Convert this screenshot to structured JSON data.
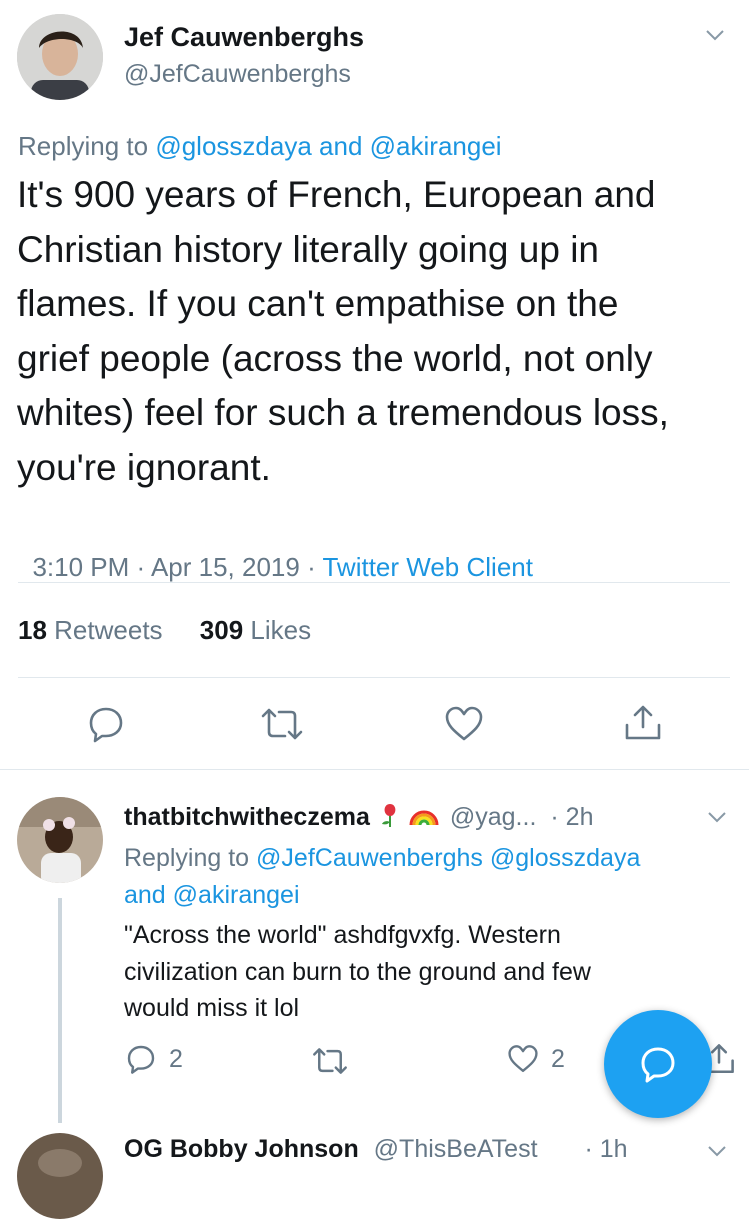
{
  "main_tweet": {
    "author_name": "Jef Cauwenberghs",
    "author_handle": "@JefCauwenberghs",
    "replying_prefix": "Replying to",
    "replying_user1": "@glosszdaya",
    "replying_and": "and",
    "replying_user2": "@akirangei",
    "text_lines": [
      "It's 900 years of French, European and",
      "Christian history literally going up in",
      "flames. If you can't empathise on the",
      "grief people (across the world, not only",
      "whites) feel for such a tremendous loss,",
      "you're ignorant."
    ],
    "timestamp": "3:10 PM · Apr 15, 2019 · ",
    "source": "Twitter Web Client",
    "retweets_count": "18",
    "retweets_label": "Retweets",
    "likes_count": "309",
    "likes_label": "Likes"
  },
  "reply": {
    "author_name": "thatbitchwitheczema",
    "emojis": [
      "rose-emoji",
      "rainbow-emoji"
    ],
    "handle": "@yag...",
    "time": "· 2h",
    "replying_prefix": "Replying to",
    "replying_user1": "@JefCauwenberghs",
    "replying_user2": "@glosszdaya",
    "replying_and": "and",
    "replying_user3": "@akirangei",
    "text_lines": [
      "\"Across the world\" ashdfgvxfg. Western",
      "civilization can burn to the ground and few",
      "would miss it lol"
    ],
    "reply_count": "2",
    "like_count": "2"
  },
  "next_reply": {
    "author_name": "OG Bobby Johnson",
    "handle": "@ThisBeATest",
    "time": "· 1h"
  },
  "colors": {
    "accent": "#1da1f2",
    "link": "#1b95e0",
    "secondary_text": "#657786",
    "divider": "#e1e8ed"
  }
}
